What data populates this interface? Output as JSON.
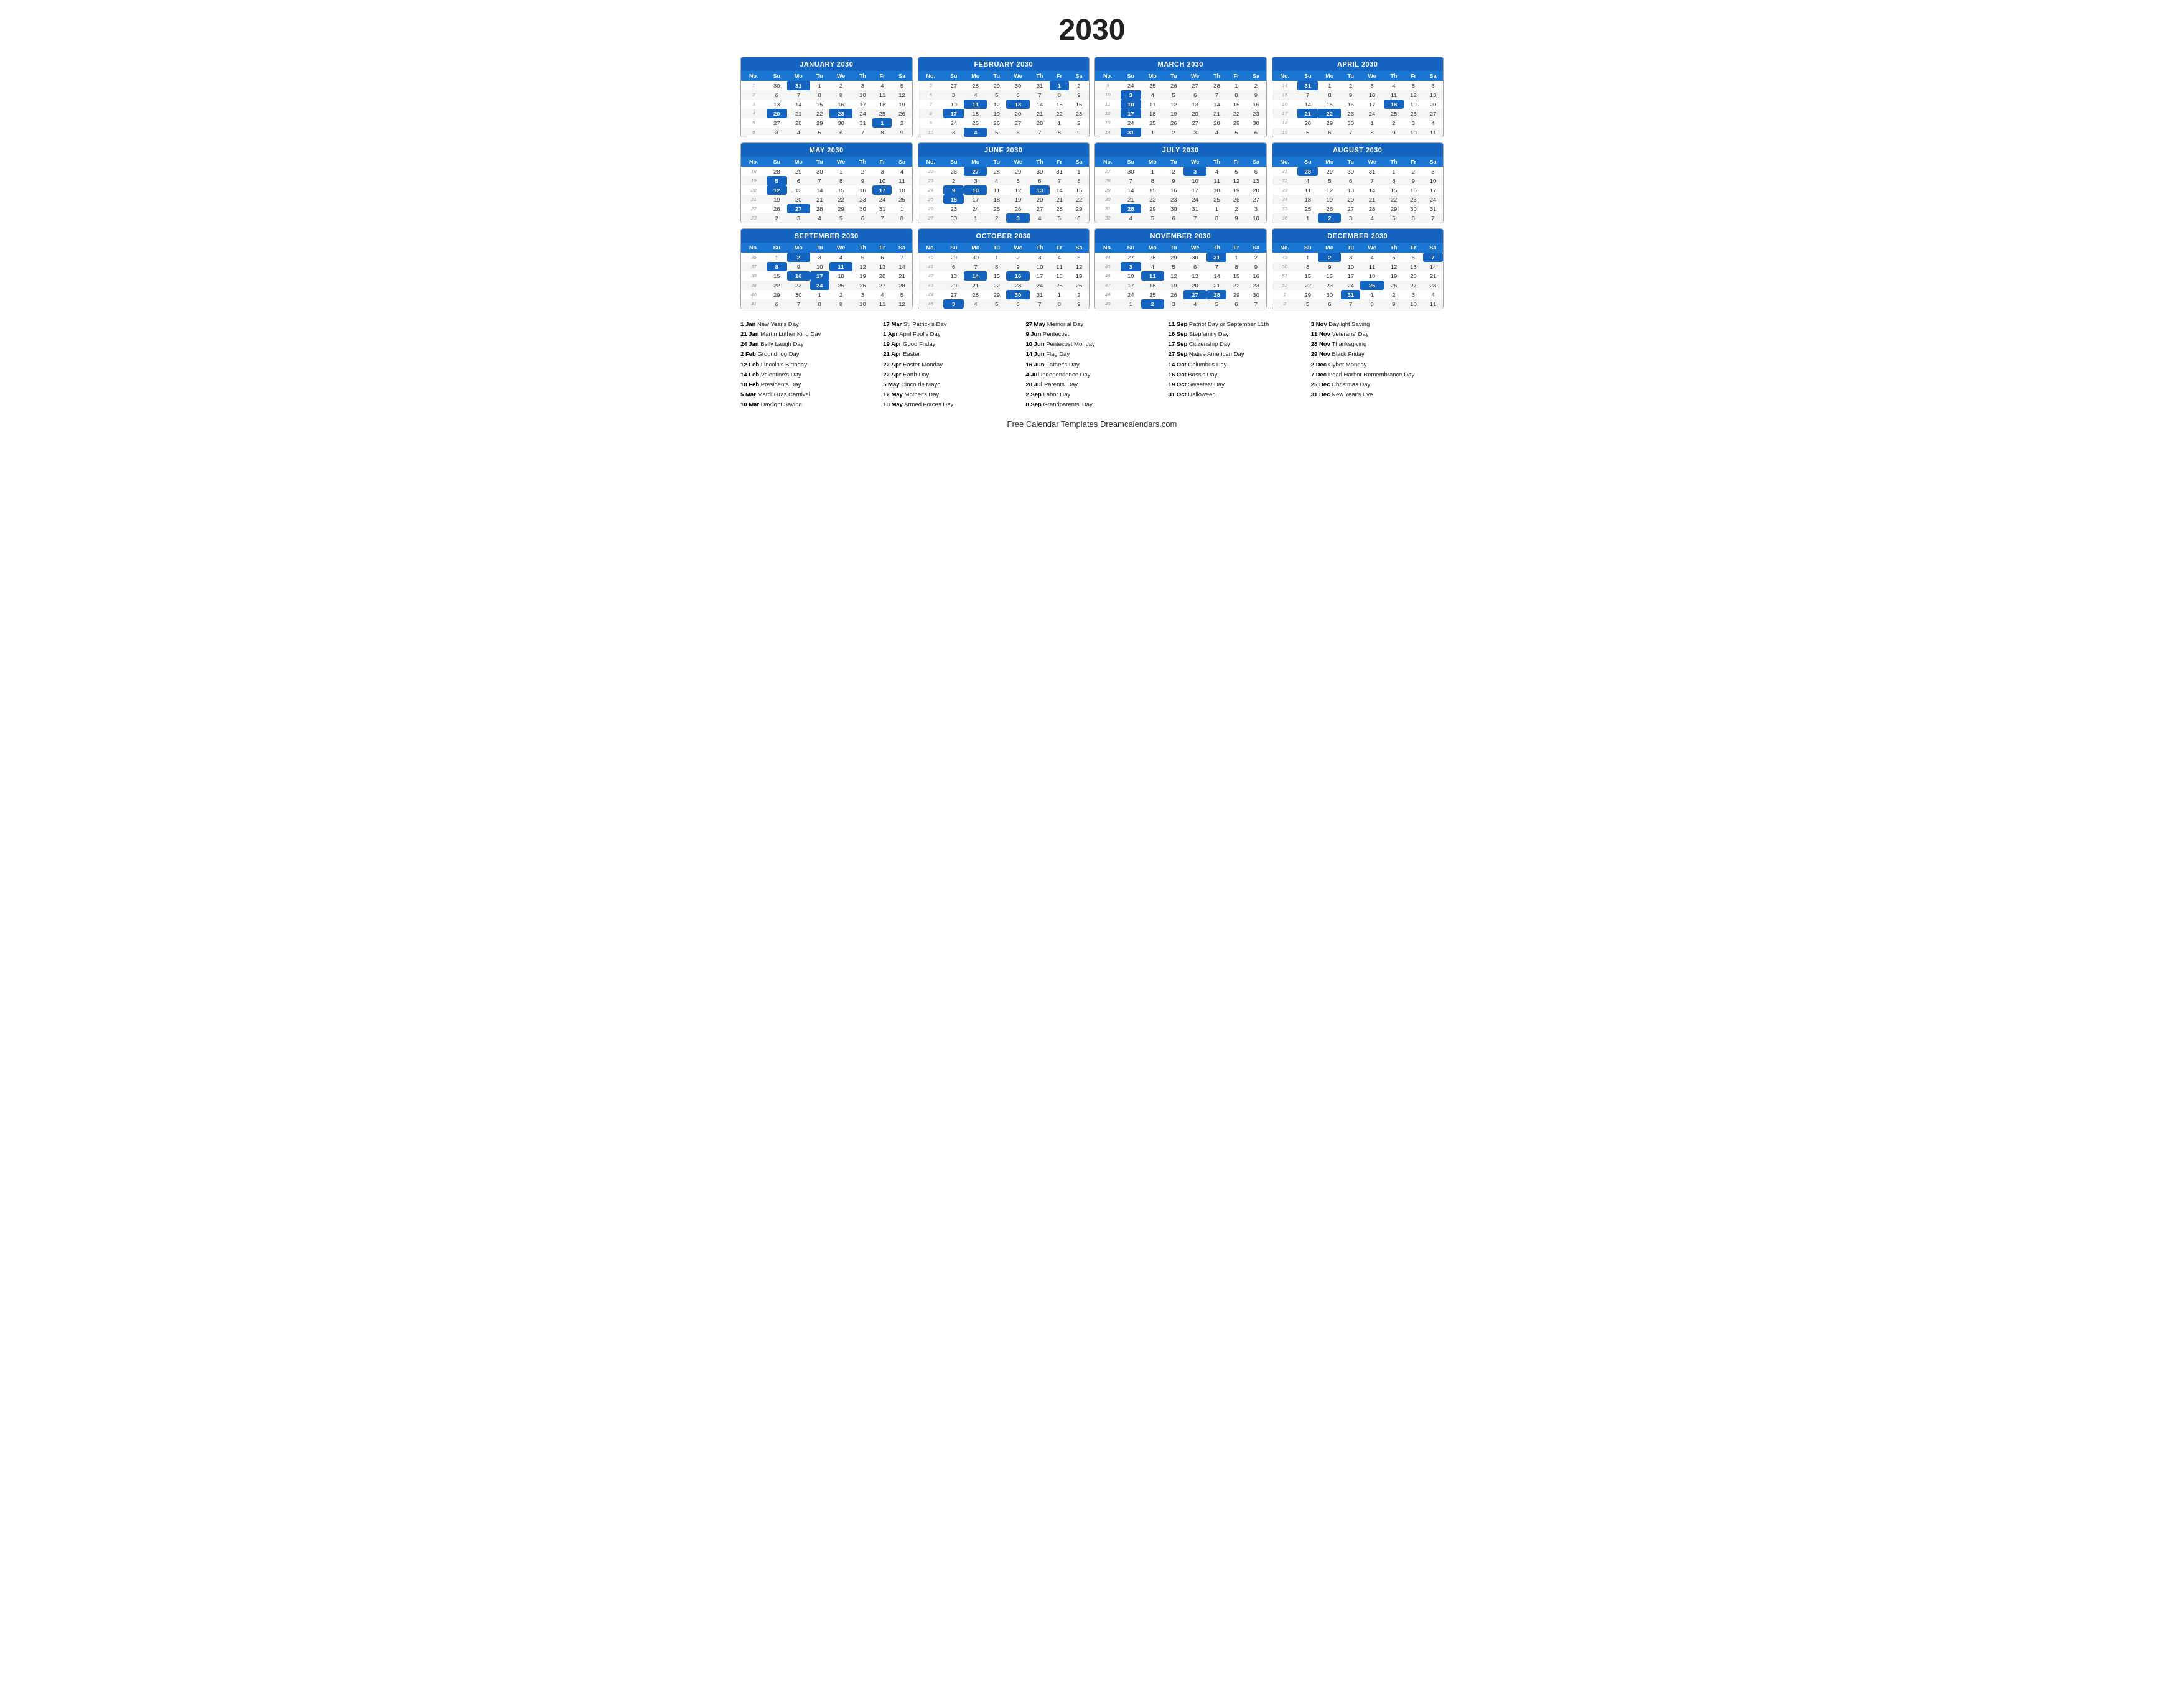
{
  "title": "2030",
  "months": [
    {
      "name": "JANUARY 2030",
      "headers": [
        "No.",
        "Su",
        "Mo",
        "Tu",
        "We",
        "Th",
        "Fr",
        "Sa"
      ],
      "rows": [
        [
          "1",
          "30",
          "31",
          "1",
          "2",
          "3",
          "4",
          "5"
        ],
        [
          "2",
          "6",
          "7",
          "8",
          "9",
          "10",
          "11",
          "12"
        ],
        [
          "3",
          "13",
          "14",
          "15",
          "16",
          "17",
          "18",
          "19"
        ],
        [
          "4",
          "20",
          "21",
          "22",
          "23",
          "24",
          "25",
          "26"
        ],
        [
          "5",
          "27",
          "28",
          "29",
          "30",
          "31",
          "1",
          "2"
        ],
        [
          "6",
          "3",
          "4",
          "5",
          "6",
          "7",
          "8",
          "9"
        ]
      ],
      "highlights": {
        "1,3": true,
        "4,2": true,
        "4,5": true,
        "5,7": true
      }
    },
    {
      "name": "FEBRUARY 2030",
      "headers": [
        "No.",
        "Su",
        "Mo",
        "Tu",
        "We",
        "Th",
        "Fr",
        "Sa"
      ],
      "rows": [
        [
          "5",
          "27",
          "28",
          "29",
          "30",
          "31",
          "1",
          "2"
        ],
        [
          "6",
          "3",
          "4",
          "5",
          "6",
          "7",
          "8",
          "9"
        ],
        [
          "7",
          "10",
          "11",
          "12",
          "13",
          "14",
          "15",
          "16"
        ],
        [
          "8",
          "17",
          "18",
          "19",
          "20",
          "21",
          "22",
          "23"
        ],
        [
          "9",
          "24",
          "25",
          "26",
          "27",
          "28",
          "1",
          "2"
        ],
        [
          "10",
          "3",
          "4",
          "5",
          "6",
          "7",
          "8",
          "9"
        ]
      ],
      "highlights": {
        "1,7": true,
        "3,3": true,
        "3,5": true,
        "4,2": true,
        "6,3": true
      }
    },
    {
      "name": "MARCH 2030",
      "headers": [
        "No.",
        "Su",
        "Mo",
        "Tu",
        "We",
        "Th",
        "Fr",
        "Sa"
      ],
      "rows": [
        [
          "9",
          "24",
          "25",
          "26",
          "27",
          "28",
          "1",
          "2"
        ],
        [
          "10",
          "3",
          "4",
          "5",
          "6",
          "7",
          "8",
          "9"
        ],
        [
          "11",
          "10",
          "11",
          "12",
          "13",
          "14",
          "15",
          "16"
        ],
        [
          "12",
          "17",
          "18",
          "19",
          "20",
          "21",
          "22",
          "23"
        ],
        [
          "13",
          "24",
          "25",
          "26",
          "27",
          "28",
          "29",
          "30"
        ],
        [
          "14",
          "31",
          "1",
          "2",
          "3",
          "4",
          "5",
          "6"
        ]
      ],
      "highlights": {
        "2,2": true,
        "3,2": true,
        "4,2": true,
        "6,2": true
      }
    },
    {
      "name": "APRIL 2030",
      "headers": [
        "No.",
        "Su",
        "Mo",
        "Tu",
        "We",
        "Th",
        "Fr",
        "Sa"
      ],
      "rows": [
        [
          "14",
          "31",
          "1",
          "2",
          "3",
          "4",
          "5",
          "6"
        ],
        [
          "15",
          "7",
          "8",
          "9",
          "10",
          "11",
          "12",
          "13"
        ],
        [
          "16",
          "14",
          "15",
          "16",
          "17",
          "18",
          "19",
          "20"
        ],
        [
          "17",
          "21",
          "22",
          "23",
          "24",
          "25",
          "26",
          "27"
        ],
        [
          "18",
          "28",
          "29",
          "30",
          "1",
          "2",
          "3",
          "4"
        ],
        [
          "19",
          "5",
          "6",
          "7",
          "8",
          "9",
          "10",
          "11"
        ]
      ],
      "highlights": {
        "1,2": true,
        "3,6": true,
        "4,2": true,
        "4,3": true
      }
    },
    {
      "name": "MAY 2030",
      "headers": [
        "No.",
        "Su",
        "Mo",
        "Tu",
        "We",
        "Th",
        "Fr",
        "Sa"
      ],
      "rows": [
        [
          "18",
          "28",
          "29",
          "30",
          "1",
          "2",
          "3",
          "4"
        ],
        [
          "19",
          "5",
          "6",
          "7",
          "8",
          "9",
          "10",
          "11"
        ],
        [
          "20",
          "12",
          "13",
          "14",
          "15",
          "16",
          "17",
          "18"
        ],
        [
          "21",
          "19",
          "20",
          "21",
          "22",
          "23",
          "24",
          "25"
        ],
        [
          "22",
          "26",
          "27",
          "28",
          "29",
          "30",
          "31",
          "1"
        ],
        [
          "23",
          "2",
          "3",
          "4",
          "5",
          "6",
          "7",
          "8"
        ]
      ],
      "highlights": {
        "2,2": true,
        "3,2": true,
        "3,7": true,
        "5,3": true
      }
    },
    {
      "name": "JUNE 2030",
      "headers": [
        "No.",
        "Su",
        "Mo",
        "Tu",
        "We",
        "Th",
        "Fr",
        "Sa"
      ],
      "rows": [
        [
          "22",
          "26",
          "27",
          "28",
          "29",
          "30",
          "31",
          "1"
        ],
        [
          "23",
          "2",
          "3",
          "4",
          "5",
          "6",
          "7",
          "8"
        ],
        [
          "24",
          "9",
          "10",
          "11",
          "12",
          "13",
          "14",
          "15"
        ],
        [
          "25",
          "16",
          "17",
          "18",
          "19",
          "20",
          "21",
          "22"
        ],
        [
          "26",
          "23",
          "24",
          "25",
          "26",
          "27",
          "28",
          "29"
        ],
        [
          "27",
          "30",
          "1",
          "2",
          "3",
          "4",
          "5",
          "6"
        ]
      ],
      "highlights": {
        "1,3": true,
        "3,2": true,
        "3,3": true,
        "3,6": true,
        "4,2": true,
        "6,5": true
      }
    },
    {
      "name": "JULY 2030",
      "headers": [
        "No.",
        "Su",
        "Mo",
        "Tu",
        "We",
        "Th",
        "Fr",
        "Sa"
      ],
      "rows": [
        [
          "27",
          "30",
          "1",
          "2",
          "3",
          "4",
          "5",
          "6"
        ],
        [
          "28",
          "7",
          "8",
          "9",
          "10",
          "11",
          "12",
          "13"
        ],
        [
          "29",
          "14",
          "15",
          "16",
          "17",
          "18",
          "19",
          "20"
        ],
        [
          "30",
          "21",
          "22",
          "23",
          "24",
          "25",
          "26",
          "27"
        ],
        [
          "31",
          "28",
          "29",
          "30",
          "31",
          "1",
          "2",
          "3"
        ],
        [
          "32",
          "4",
          "5",
          "6",
          "7",
          "8",
          "9",
          "10"
        ]
      ],
      "highlights": {
        "1,5": true,
        "5,2": true
      }
    },
    {
      "name": "AUGUST 2030",
      "headers": [
        "No.",
        "Su",
        "Mo",
        "Tu",
        "We",
        "Th",
        "Fr",
        "Sa"
      ],
      "rows": [
        [
          "31",
          "28",
          "29",
          "30",
          "31",
          "1",
          "2",
          "3"
        ],
        [
          "32",
          "4",
          "5",
          "6",
          "7",
          "8",
          "9",
          "10"
        ],
        [
          "33",
          "11",
          "12",
          "13",
          "14",
          "15",
          "16",
          "17"
        ],
        [
          "34",
          "18",
          "19",
          "20",
          "21",
          "22",
          "23",
          "24"
        ],
        [
          "35",
          "25",
          "26",
          "27",
          "28",
          "29",
          "30",
          "31"
        ],
        [
          "36",
          "1",
          "2",
          "3",
          "4",
          "5",
          "6",
          "7"
        ]
      ],
      "highlights": {
        "1,2": true,
        "6,3": true
      }
    },
    {
      "name": "SEPTEMBER 2030",
      "headers": [
        "No.",
        "Su",
        "Mo",
        "Tu",
        "We",
        "Th",
        "Fr",
        "Sa"
      ],
      "rows": [
        [
          "36",
          "1",
          "2",
          "3",
          "4",
          "5",
          "6",
          "7"
        ],
        [
          "37",
          "8",
          "9",
          "10",
          "11",
          "12",
          "13",
          "14"
        ],
        [
          "38",
          "15",
          "16",
          "17",
          "18",
          "19",
          "20",
          "21"
        ],
        [
          "39",
          "22",
          "23",
          "24",
          "25",
          "26",
          "27",
          "28"
        ],
        [
          "40",
          "29",
          "30",
          "1",
          "2",
          "3",
          "4",
          "5"
        ],
        [
          "41",
          "6",
          "7",
          "8",
          "9",
          "10",
          "11",
          "12"
        ]
      ],
      "highlights": {
        "1,3": true,
        "2,2": true,
        "2,5": true,
        "3,3": true,
        "3,4": true,
        "4,4": true
      }
    },
    {
      "name": "OCTOBER 2030",
      "headers": [
        "No.",
        "Su",
        "Mo",
        "Tu",
        "We",
        "Th",
        "Fr",
        "Sa"
      ],
      "rows": [
        [
          "40",
          "29",
          "30",
          "1",
          "2",
          "3",
          "4",
          "5"
        ],
        [
          "41",
          "6",
          "7",
          "8",
          "9",
          "10",
          "11",
          "12"
        ],
        [
          "42",
          "13",
          "14",
          "15",
          "16",
          "17",
          "18",
          "19"
        ],
        [
          "43",
          "20",
          "21",
          "22",
          "23",
          "24",
          "25",
          "26"
        ],
        [
          "44",
          "27",
          "28",
          "29",
          "30",
          "31",
          "1",
          "2"
        ],
        [
          "45",
          "3",
          "4",
          "5",
          "6",
          "7",
          "8",
          "9"
        ]
      ],
      "highlights": {
        "3,3": true,
        "3,5": true,
        "5,5": true,
        "6,2": true
      }
    },
    {
      "name": "NOVEMBER 2030",
      "headers": [
        "No.",
        "Su",
        "Mo",
        "Tu",
        "We",
        "Th",
        "Fr",
        "Sa"
      ],
      "rows": [
        [
          "44",
          "27",
          "28",
          "29",
          "30",
          "31",
          "1",
          "2"
        ],
        [
          "45",
          "3",
          "4",
          "5",
          "6",
          "7",
          "8",
          "9"
        ],
        [
          "46",
          "10",
          "11",
          "12",
          "13",
          "14",
          "15",
          "16"
        ],
        [
          "47",
          "17",
          "18",
          "19",
          "20",
          "21",
          "22",
          "23"
        ],
        [
          "48",
          "24",
          "25",
          "26",
          "27",
          "28",
          "29",
          "30"
        ],
        [
          "49",
          "1",
          "2",
          "3",
          "4",
          "5",
          "6",
          "7"
        ]
      ],
      "highlights": {
        "1,6": true,
        "2,2": true,
        "3,3": true,
        "5,5": true,
        "5,6": true,
        "6,3": true
      }
    },
    {
      "name": "DECEMBER 2030",
      "headers": [
        "No.",
        "Su",
        "Mo",
        "Tu",
        "We",
        "Th",
        "Fr",
        "Sa"
      ],
      "rows": [
        [
          "49",
          "1",
          "2",
          "3",
          "4",
          "5",
          "6",
          "7"
        ],
        [
          "50",
          "8",
          "9",
          "10",
          "11",
          "12",
          "13",
          "14"
        ],
        [
          "51",
          "15",
          "16",
          "17",
          "18",
          "19",
          "20",
          "21"
        ],
        [
          "52",
          "22",
          "23",
          "24",
          "25",
          "26",
          "27",
          "28"
        ],
        [
          "1",
          "29",
          "30",
          "31",
          "1",
          "2",
          "3",
          "4"
        ],
        [
          "2",
          "5",
          "6",
          "7",
          "8",
          "9",
          "10",
          "11"
        ]
      ],
      "highlights": {
        "1,3": true,
        "1,8": true,
        "4,5": true,
        "5,4": true
      }
    }
  ],
  "holidays": [
    [
      {
        "date": "1 Jan",
        "name": "New Year's Day"
      },
      {
        "date": "21 Jan",
        "name": "Martin Luther King Day"
      },
      {
        "date": "24 Jan",
        "name": "Belly Laugh Day"
      },
      {
        "date": "2 Feb",
        "name": "Groundhog Day"
      },
      {
        "date": "12 Feb",
        "name": "Lincoln's Birthday"
      },
      {
        "date": "14 Feb",
        "name": "Valentine's Day"
      },
      {
        "date": "18 Feb",
        "name": "Presidents Day"
      },
      {
        "date": "5 Mar",
        "name": "Mardi Gras Carnival"
      },
      {
        "date": "10 Mar",
        "name": "Daylight Saving"
      }
    ],
    [
      {
        "date": "17 Mar",
        "name": "St. Patrick's Day"
      },
      {
        "date": "1 Apr",
        "name": "April Fool's Day"
      },
      {
        "date": "19 Apr",
        "name": "Good Friday"
      },
      {
        "date": "21 Apr",
        "name": "Easter"
      },
      {
        "date": "22 Apr",
        "name": "Easter Monday"
      },
      {
        "date": "22 Apr",
        "name": "Earth Day"
      },
      {
        "date": "5 May",
        "name": "Cinco de Mayo"
      },
      {
        "date": "12 May",
        "name": "Mother's Day"
      },
      {
        "date": "18 May",
        "name": "Armed Forces Day"
      }
    ],
    [
      {
        "date": "27 May",
        "name": "Memorial Day"
      },
      {
        "date": "9 Jun",
        "name": "Pentecost"
      },
      {
        "date": "10 Jun",
        "name": "Pentecost Monday"
      },
      {
        "date": "14 Jun",
        "name": "Flag Day"
      },
      {
        "date": "16 Jun",
        "name": "Father's Day"
      },
      {
        "date": "4 Jul",
        "name": "Independence Day"
      },
      {
        "date": "28 Jul",
        "name": "Parents' Day"
      },
      {
        "date": "2 Sep",
        "name": "Labor Day"
      },
      {
        "date": "8 Sep",
        "name": "Grandparents' Day"
      }
    ],
    [
      {
        "date": "11 Sep",
        "name": "Patriot Day or September 11th"
      },
      {
        "date": "16 Sep",
        "name": "Stepfamily Day"
      },
      {
        "date": "17 Sep",
        "name": "Citizenship Day"
      },
      {
        "date": "27 Sep",
        "name": "Native American Day"
      },
      {
        "date": "14 Oct",
        "name": "Columbus Day"
      },
      {
        "date": "16 Oct",
        "name": "Boss's Day"
      },
      {
        "date": "19 Oct",
        "name": "Sweetest Day"
      },
      {
        "date": "31 Oct",
        "name": "Halloween"
      }
    ],
    [
      {
        "date": "3 Nov",
        "name": "Daylight Saving"
      },
      {
        "date": "11 Nov",
        "name": "Veterans' Day"
      },
      {
        "date": "28 Nov",
        "name": "Thanksgiving"
      },
      {
        "date": "29 Nov",
        "name": "Black Friday"
      },
      {
        "date": "2 Dec",
        "name": "Cyber Monday"
      },
      {
        "date": "7 Dec",
        "name": "Pearl Harbor Remembrance Day"
      },
      {
        "date": "25 Dec",
        "name": "Christmas Day"
      },
      {
        "date": "31 Dec",
        "name": "New Year's Eve"
      }
    ]
  ],
  "footer": "Free Calendar Templates Dreamcalendars.com"
}
